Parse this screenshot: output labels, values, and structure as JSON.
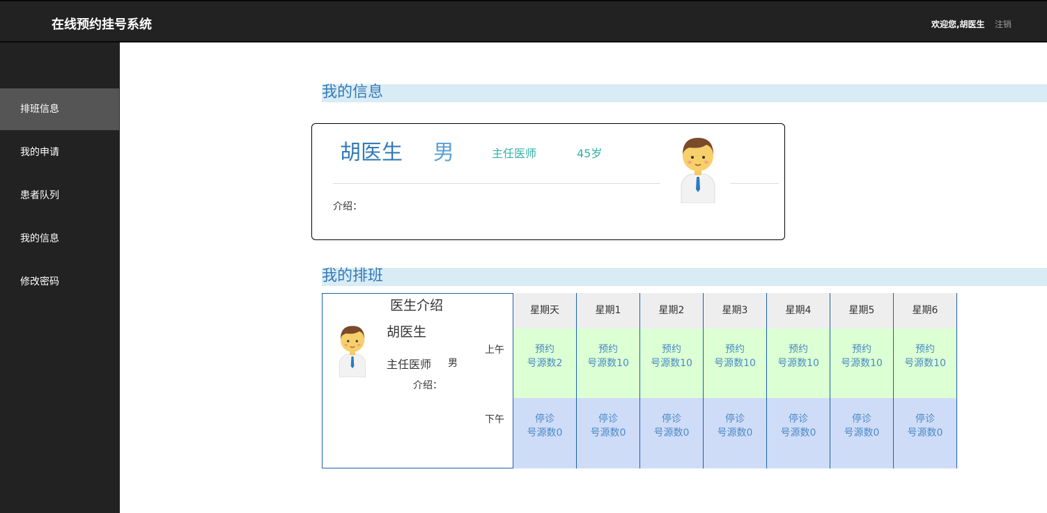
{
  "header": {
    "brand": "在线预约挂号系统",
    "welcome": "欢迎您,胡医生",
    "logout": "注销"
  },
  "sidebar": {
    "items": [
      {
        "label": "排班信息",
        "active": true
      },
      {
        "label": "我的申请",
        "active": false
      },
      {
        "label": "患者队列",
        "active": false
      },
      {
        "label": "我的信息",
        "active": false
      },
      {
        "label": "修改密码",
        "active": false
      }
    ]
  },
  "my_info": {
    "section_title": "我的信息",
    "name": "胡医生",
    "sex": "男",
    "title": "主任医师",
    "age": "45岁",
    "intro_label": "介绍："
  },
  "schedule": {
    "section_title": "我的排班",
    "intro_header": "医生介绍",
    "name": "胡医生",
    "title": "主任医师",
    "sex": "男",
    "intro_label": "介绍：",
    "am_label": "上午",
    "pm_label": "下午",
    "days": [
      "星期天",
      "星期1",
      "星期2",
      "星期3",
      "星期4",
      "星期5",
      "星期6"
    ],
    "am": [
      {
        "status": "预约",
        "count": "号源数2"
      },
      {
        "status": "预约",
        "count": "号源数10"
      },
      {
        "status": "预约",
        "count": "号源数10"
      },
      {
        "status": "预约",
        "count": "号源数10"
      },
      {
        "status": "预约",
        "count": "号源数10"
      },
      {
        "status": "预约",
        "count": "号源数10"
      },
      {
        "status": "预约",
        "count": "号源数10"
      }
    ],
    "pm": [
      {
        "status": "停诊",
        "count": "号源数0"
      },
      {
        "status": "停诊",
        "count": "号源数0"
      },
      {
        "status": "停诊",
        "count": "号源数0"
      },
      {
        "status": "停诊",
        "count": "号源数0"
      },
      {
        "status": "停诊",
        "count": "号源数0"
      },
      {
        "status": "停诊",
        "count": "号源数0"
      },
      {
        "status": "停诊",
        "count": "号源数0"
      }
    ]
  }
}
